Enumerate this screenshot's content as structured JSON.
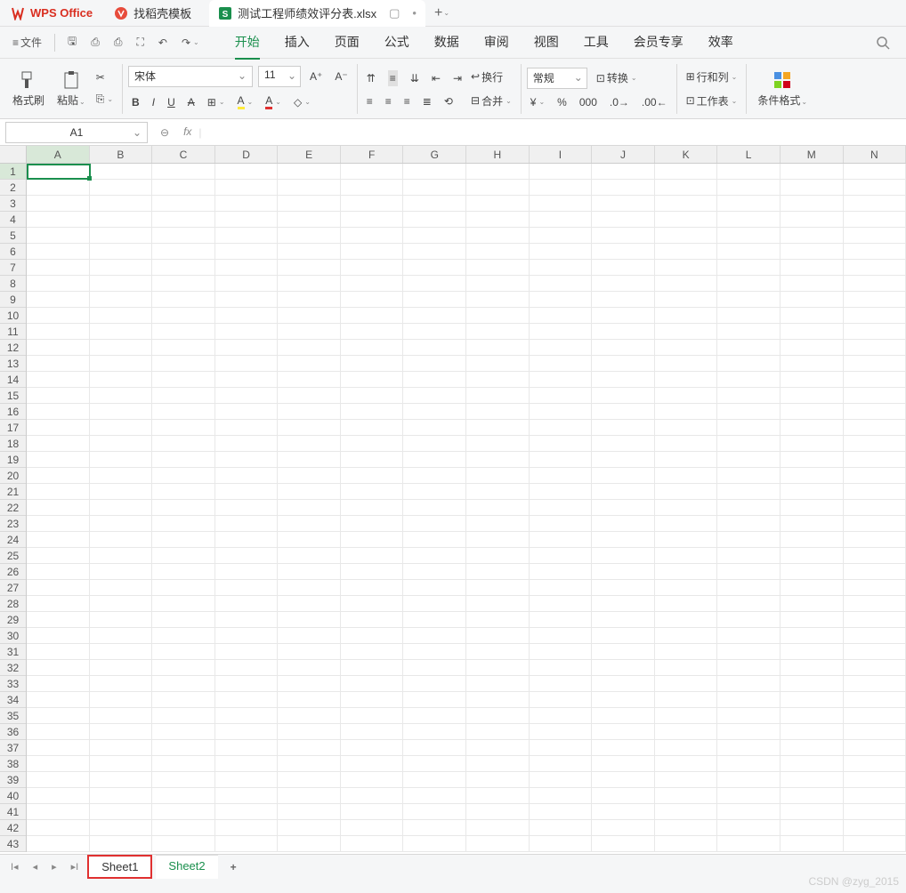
{
  "titlebar": {
    "wps_label": "WPS Office",
    "daoke_label": "找稻壳模板",
    "file_label": "测试工程师绩效评分表.xlsx",
    "add": "+"
  },
  "menubar": {
    "file": "文件",
    "tabs": [
      "开始",
      "插入",
      "页面",
      "公式",
      "数据",
      "审阅",
      "视图",
      "工具",
      "会员专享",
      "效率"
    ],
    "active_tab": 0
  },
  "ribbon": {
    "format_brush": "格式刷",
    "paste": "粘贴",
    "font_name": "宋体",
    "font_size": "11",
    "wrap": "换行",
    "merge": "合并",
    "number_format": "常规",
    "convert": "转换",
    "rowcol": "行和列",
    "worksheet": "工作表",
    "cond_fmt": "条件格式"
  },
  "formulabar": {
    "cell_ref": "A1",
    "fx": "fx",
    "value": ""
  },
  "grid": {
    "columns": [
      "A",
      "B",
      "C",
      "D",
      "E",
      "F",
      "G",
      "H",
      "I",
      "J",
      "K",
      "L",
      "M",
      "N"
    ],
    "rows": [
      1,
      2,
      3,
      4,
      5,
      6,
      7,
      8,
      9,
      10,
      11,
      12,
      13,
      14,
      15,
      16,
      17,
      18,
      19,
      20,
      21,
      22,
      23,
      24,
      25,
      26,
      27,
      28,
      29,
      30,
      31,
      32,
      33,
      34,
      35,
      36,
      37,
      38,
      39,
      40,
      41,
      42,
      43
    ],
    "selected_col": 0,
    "selected_row": 0
  },
  "sheetbar": {
    "tabs": [
      "Sheet1",
      "Sheet2"
    ],
    "selected": 0,
    "add": "+"
  },
  "watermark": "CSDN @zyg_2015"
}
